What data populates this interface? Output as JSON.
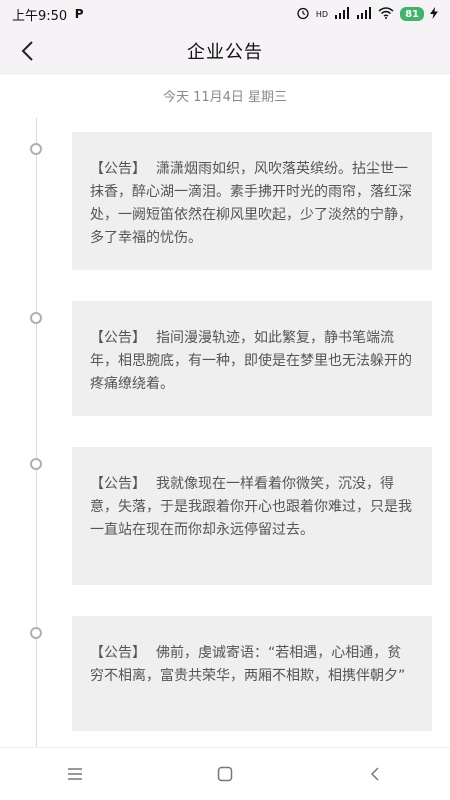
{
  "status_bar": {
    "time": "上午9:50",
    "app_badge": "P",
    "network_label": "HD",
    "battery_level": "81",
    "icons": [
      "alarm-icon",
      "signal-icon",
      "signal-icon",
      "wifi-icon",
      "battery-icon",
      "charging-icon"
    ]
  },
  "header": {
    "title": "企业公告",
    "back_icon": "chevron-left-icon"
  },
  "date": "今天 11月4日 星期三",
  "announcements": [
    {
      "tag": "【公告】",
      "text": "潇潇烟雨如织，风吹落英缤纷。拈尘世一抹香，醉心湖一滴泪。素手拂开时光的雨帘，落红深处，一阙短笛依然在柳风里吹起，少了淡然的宁静，多了幸福的忧伤。"
    },
    {
      "tag": "【公告】",
      "text": "指间漫漫轨迹，如此繁复，静书笔端流年，相思腕底，有一种，即使是在梦里也无法躲开的疼痛缭绕着。"
    },
    {
      "tag": "【公告】",
      "text": "我就像现在一样看着你微笑，沉没，得意，失落，于是我跟着你开心也跟着你难过，只是我一直站在现在而你却永远停留过去。"
    },
    {
      "tag": "【公告】",
      "text": "佛前，虔诚寄语：“若相遇，心相通，贫穷不相离，富贵共荣华，两厢不相欺，相携伴朝夕”"
    }
  ],
  "bottom_nav": {
    "icons": [
      "menu-icon",
      "home-icon",
      "back-icon"
    ]
  }
}
